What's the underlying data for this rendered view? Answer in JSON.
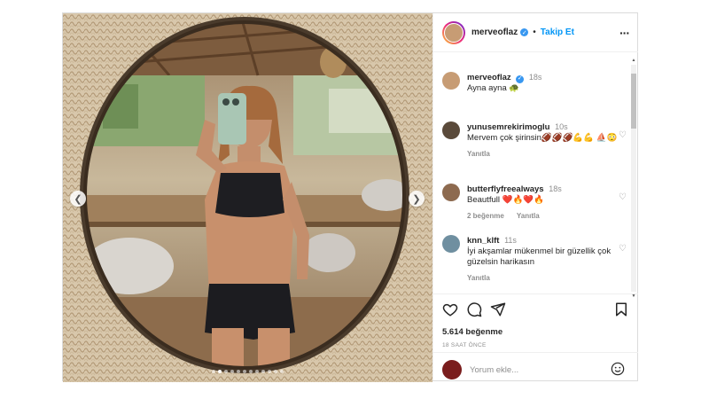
{
  "header": {
    "username": "merveoflaz",
    "separator": "•",
    "follow_label": "Takip Et",
    "more_label": "···"
  },
  "caption": {
    "username": "merveoflaz",
    "time": "18s",
    "text": "Ayna ayna 🐢"
  },
  "comments": [
    {
      "username": "yunusemrekirimoglu",
      "time": "10s",
      "text": "Mervem çok şirinsin🏈🏈🏈💪💪 ⛵😳",
      "reply_label": "Yanıtla",
      "likes_label": ""
    },
    {
      "username": "butterflyfreealways",
      "time": "18s",
      "text": "Beautfull ❤️🔥❤️🔥",
      "likes_label": "2 beğenme",
      "reply_label": "Yanıtla"
    },
    {
      "username": "knn_klft",
      "time": "11s",
      "text": "İyi akşamlar mükenmel bir güzellik çok güzelsin harikasın",
      "reply_label": "Yanıtla",
      "likes_label": ""
    }
  ],
  "stats": {
    "likes": "5.614 beğenme",
    "time_ago": "18 SAAT ÖNCE"
  },
  "add_comment": {
    "placeholder": "Yorum ekle..."
  },
  "carousel": {
    "total": 12,
    "active_index": 1
  },
  "icons": [
    "heart-icon",
    "comment-icon",
    "share-icon",
    "bookmark-icon",
    "emoji-icon",
    "more-icon",
    "chevron-left-icon",
    "chevron-right-icon",
    "verified-icon"
  ],
  "colors": {
    "accent": "#0095f6",
    "verified": "#3897f0",
    "secondary_text": "#8e8e8e"
  }
}
